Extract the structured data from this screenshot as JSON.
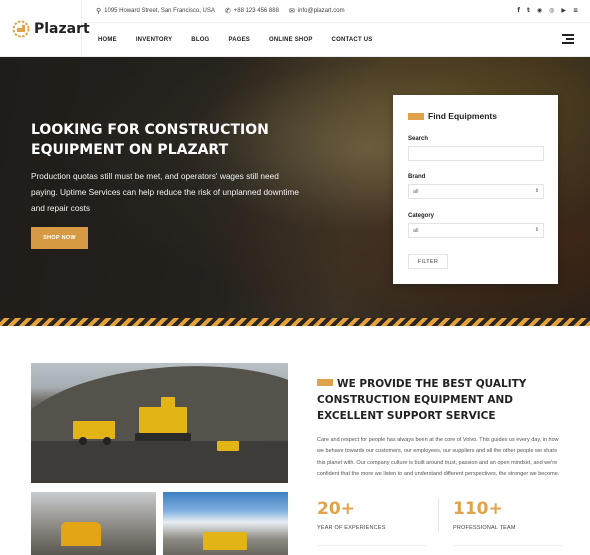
{
  "brand": {
    "name": "Plazart",
    "accent": "#e0a24b"
  },
  "topbar": {
    "address": "1095 Howard Street, San Francisco, USA",
    "phone": "+88 123 456 888",
    "email": "info@plazart.com",
    "socials": [
      "facebook-icon",
      "twitter-icon",
      "github-icon",
      "instagram-icon",
      "youtube-icon",
      "stack-icon"
    ]
  },
  "nav": {
    "items": [
      "HOME",
      "INVENTORY",
      "BLOG",
      "PAGES",
      "ONLINE SHOP",
      "CONTACT US"
    ]
  },
  "hero": {
    "title": "LOOKING FOR CONSTRUCTION EQUIPMENT ON PLAZART",
    "text": "Production quotas still must be met, and operators' wages still need paying. Uptime Services can help reduce the risk of unplanned downtime and repair costs",
    "button": "SHOP NOW"
  },
  "finder": {
    "title": "Find Equipments",
    "search_label": "Search",
    "search_value": "",
    "brand_label": "Brand",
    "brand_value": "all",
    "category_label": "Category",
    "category_value": "all",
    "filter_button": "FILTER"
  },
  "about": {
    "title": "WE PROVIDE THE BEST QUALITY CONSTRUCTION EQUIPMENT AND EXCELLENT SUPPORT SERVICE",
    "text": "Care and respect for people has always been at the core of Volvo. This guides us every day, in how we behave towards our customers, our employees, our suppliers and all the other people we share this planet with. Our company culture is built around trust, passion and an open mindset, and we're confident that the more we listen to and understand different perspectives, the stronger we become.",
    "stats": [
      {
        "value": "20+",
        "label": "YEAR OF EXPERIENCES"
      },
      {
        "value": "110+",
        "label": "PROFESSIONAL TEAM"
      }
    ]
  }
}
